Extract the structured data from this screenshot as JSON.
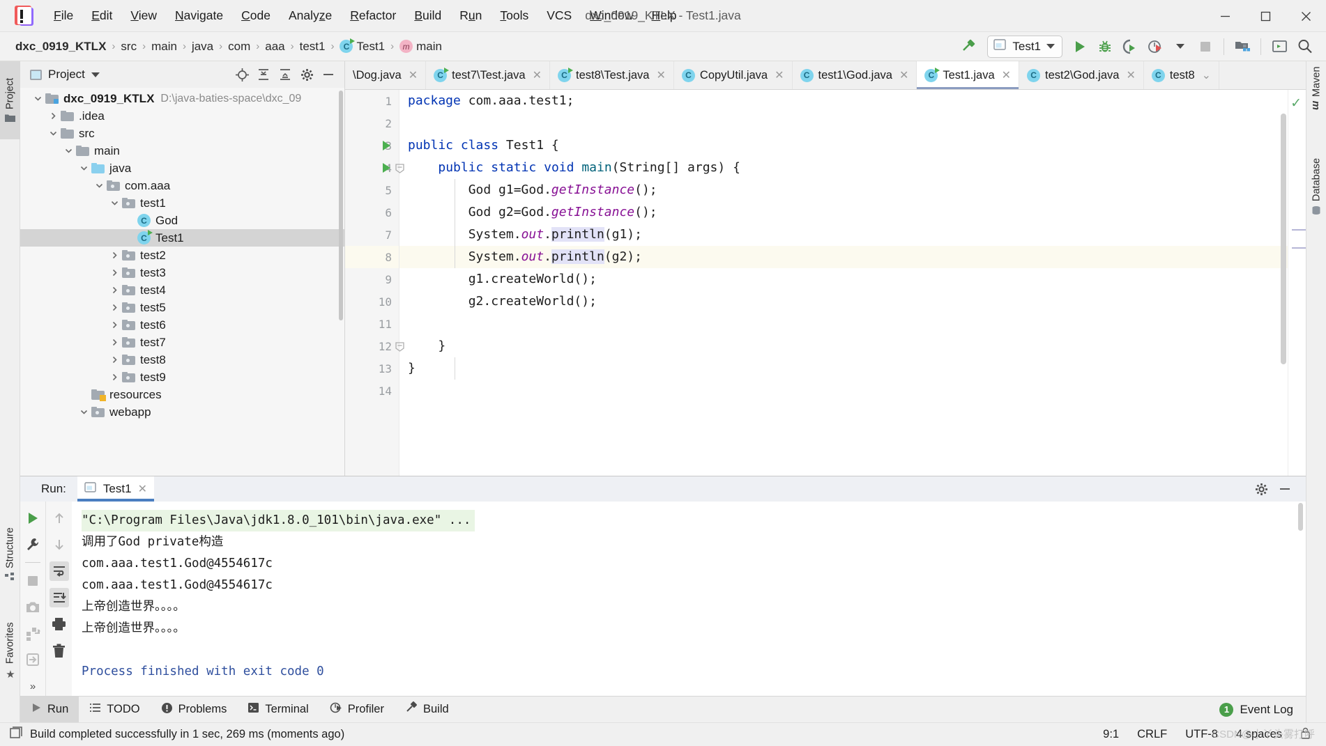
{
  "window": {
    "title": "dxc_0919_KTLX - Test1.java",
    "logo_icon": "intellij-idea-logo",
    "minimize_icon": "minimize-icon",
    "maximize_icon": "maximize-icon",
    "close_icon": "close-icon"
  },
  "menu": [
    {
      "label": "File",
      "mnemonic": "F"
    },
    {
      "label": "Edit",
      "mnemonic": "E"
    },
    {
      "label": "View",
      "mnemonic": "V"
    },
    {
      "label": "Navigate",
      "mnemonic": "N"
    },
    {
      "label": "Code",
      "mnemonic": "C"
    },
    {
      "label": "Analyze",
      "mnemonic": "z"
    },
    {
      "label": "Refactor",
      "mnemonic": "R"
    },
    {
      "label": "Build",
      "mnemonic": "B"
    },
    {
      "label": "Run",
      "mnemonic": "u"
    },
    {
      "label": "Tools",
      "mnemonic": "T"
    },
    {
      "label": "VCS",
      "mnemonic": ""
    },
    {
      "label": "Window",
      "mnemonic": "W"
    },
    {
      "label": "Help",
      "mnemonic": "H"
    }
  ],
  "breadcrumbs": [
    {
      "label": "dxc_0919_KTLX",
      "icon": "",
      "bold": true
    },
    {
      "label": "src",
      "icon": ""
    },
    {
      "label": "main",
      "icon": ""
    },
    {
      "label": "java",
      "icon": ""
    },
    {
      "label": "com",
      "icon": ""
    },
    {
      "label": "aaa",
      "icon": ""
    },
    {
      "label": "test1",
      "icon": ""
    },
    {
      "label": "Test1",
      "icon": "class-icon"
    },
    {
      "label": "main",
      "icon": "method-icon"
    }
  ],
  "toolbar": {
    "build_icon": "hammer-icon",
    "run_config_label": "Test1",
    "run_config_icon": "run-config-icon",
    "run_icon": "run-icon",
    "debug_icon": "debug-bug-icon",
    "coverage_icon": "run-with-coverage-icon",
    "profile_icon": "profiler-icon",
    "stop_icon": "stop-icon",
    "project_structure_icon": "project-structure-icon",
    "updates_icon": "terminal-icon",
    "search_icon": "search-everywhere-icon"
  },
  "left_strip": [
    {
      "label": "Project",
      "icon": "project-folder-icon",
      "active": true
    },
    {
      "label": "Structure",
      "icon": "structure-icon",
      "active": false
    },
    {
      "label": "Favorites",
      "icon": "star-icon",
      "active": false
    }
  ],
  "right_strip": [
    {
      "label": "Maven",
      "icon": "maven-icon"
    },
    {
      "label": "Database",
      "icon": "database-icon"
    }
  ],
  "project_panel": {
    "title": "Project",
    "title_icon": "project-window-icon",
    "dropdown_icon": "chevron-down-icon",
    "actions": [
      {
        "icon": "locate-icon",
        "name": "select-opened-file"
      },
      {
        "icon": "expand-all-icon",
        "name": "expand-all"
      },
      {
        "icon": "collapse-all-icon",
        "name": "collapse-all"
      },
      {
        "icon": "gear-icon",
        "name": "options"
      },
      {
        "icon": "minimize-icon",
        "name": "hide-panel"
      }
    ],
    "tree": [
      {
        "label": "dxc_0919_KTLX",
        "path": "D:\\java-baties-space\\dxc_09",
        "depth": 0,
        "arrow": "down",
        "icon": "module-folder",
        "bold": true
      },
      {
        "label": ".idea",
        "path": "",
        "depth": 1,
        "arrow": "right",
        "icon": "folder"
      },
      {
        "label": "src",
        "path": "",
        "depth": 1,
        "arrow": "down",
        "icon": "folder"
      },
      {
        "label": "main",
        "path": "",
        "depth": 2,
        "arrow": "down",
        "icon": "folder"
      },
      {
        "label": "java",
        "path": "",
        "depth": 3,
        "arrow": "down",
        "icon": "source-folder"
      },
      {
        "label": "com.aaa",
        "path": "",
        "depth": 4,
        "arrow": "down",
        "icon": "package"
      },
      {
        "label": "test1",
        "path": "",
        "depth": 5,
        "arrow": "down",
        "icon": "package"
      },
      {
        "label": "God",
        "path": "",
        "depth": 6,
        "arrow": "none",
        "icon": "class"
      },
      {
        "label": "Test1",
        "path": "",
        "depth": 6,
        "arrow": "none",
        "icon": "class-runnable",
        "selected": true
      },
      {
        "label": "test2",
        "path": "",
        "depth": 5,
        "arrow": "right",
        "icon": "package"
      },
      {
        "label": "test3",
        "path": "",
        "depth": 5,
        "arrow": "right",
        "icon": "package"
      },
      {
        "label": "test4",
        "path": "",
        "depth": 5,
        "arrow": "right",
        "icon": "package"
      },
      {
        "label": "test5",
        "path": "",
        "depth": 5,
        "arrow": "right",
        "icon": "package"
      },
      {
        "label": "test6",
        "path": "",
        "depth": 5,
        "arrow": "right",
        "icon": "package"
      },
      {
        "label": "test7",
        "path": "",
        "depth": 5,
        "arrow": "right",
        "icon": "package"
      },
      {
        "label": "test8",
        "path": "",
        "depth": 5,
        "arrow": "right",
        "icon": "package"
      },
      {
        "label": "test9",
        "path": "",
        "depth": 5,
        "arrow": "right",
        "icon": "package"
      },
      {
        "label": "resources",
        "path": "",
        "depth": 3,
        "arrow": "none",
        "icon": "resource-folder"
      },
      {
        "label": "webapp",
        "path": "",
        "depth": 3,
        "arrow": "down",
        "icon": "package"
      }
    ]
  },
  "editor": {
    "tabs": [
      {
        "label": "\\Dog.java",
        "icon": "class-icon",
        "active": false,
        "partial": true
      },
      {
        "label": "test7\\Test.java",
        "icon": "class-runnable-icon",
        "active": false
      },
      {
        "label": "test8\\Test.java",
        "icon": "class-runnable-icon",
        "active": false
      },
      {
        "label": "CopyUtil.java",
        "icon": "class-icon",
        "active": false
      },
      {
        "label": "test1\\God.java",
        "icon": "class-icon",
        "active": false
      },
      {
        "label": "Test1.java",
        "icon": "class-runnable-icon",
        "active": true
      },
      {
        "label": "test2\\God.java",
        "icon": "class-icon",
        "active": false
      },
      {
        "label": "test8",
        "icon": "class-icon",
        "active": false,
        "truncated": true
      }
    ],
    "tabs_overflow_icon": "chevron-down-icon",
    "inspection_ok_icon": "inspection-ok-check",
    "current_line": 8,
    "lines": [
      {
        "n": 1,
        "text": "package com.aaa.test1;",
        "runnable": false
      },
      {
        "n": 2,
        "text": "",
        "runnable": false
      },
      {
        "n": 3,
        "text": "public class Test1 {",
        "runnable": true
      },
      {
        "n": 4,
        "text": "    public static void main(String[] args) {",
        "runnable": true,
        "fold": true
      },
      {
        "n": 5,
        "text": "        God g1=God.getInstance();",
        "runnable": false
      },
      {
        "n": 6,
        "text": "        God g2=God.getInstance();",
        "runnable": false
      },
      {
        "n": 7,
        "text": "        System.out.println(g1);",
        "runnable": false
      },
      {
        "n": 8,
        "text": "        System.out.println(g2);",
        "runnable": false
      },
      {
        "n": 9,
        "text": "        g1.createWorld();",
        "runnable": false
      },
      {
        "n": 10,
        "text": "        g2.createWorld();",
        "runnable": false
      },
      {
        "n": 11,
        "text": "",
        "runnable": false
      },
      {
        "n": 12,
        "text": "    }",
        "runnable": false,
        "fold": true
      },
      {
        "n": 13,
        "text": "}",
        "runnable": false
      },
      {
        "n": 14,
        "text": "",
        "runnable": false
      }
    ]
  },
  "run_panel": {
    "label": "Run:",
    "tab_label": "Test1",
    "tab_icon": "run-config-icon",
    "close_icon": "close-icon",
    "settings_icon": "gear-icon",
    "minimize_icon": "minimize-icon",
    "left_actions": [
      {
        "icon": "rerun-icon",
        "name": "rerun-button"
      },
      {
        "icon": "wrench-icon",
        "name": "edit-configuration-button"
      },
      {
        "icon": "stop-icon",
        "name": "stop-button"
      },
      {
        "icon": "camera-icon",
        "name": "snapshot-button"
      },
      {
        "icon": "dump-threads-icon",
        "name": "dump-threads-button"
      },
      {
        "icon": "exit-icon",
        "name": "exit-button"
      },
      {
        "icon": "more-icon",
        "name": "more-actions-button"
      }
    ],
    "right_actions": [
      {
        "icon": "arrow-up-icon",
        "name": "previous-occurrence"
      },
      {
        "icon": "arrow-down-icon",
        "name": "next-occurrence"
      },
      {
        "icon": "soft-wrap-icon",
        "name": "soft-wrap-toggle"
      },
      {
        "icon": "scroll-to-end-icon",
        "name": "scroll-to-end"
      },
      {
        "icon": "print-icon",
        "name": "print-button"
      },
      {
        "icon": "trash-icon",
        "name": "clear-all-button"
      }
    ],
    "console_lines": [
      {
        "text": "\"C:\\Program Files\\Java\\jdk1.8.0_101\\bin\\java.exe\" ...",
        "style": "command"
      },
      {
        "text": "调用了God private构造",
        "style": "normal"
      },
      {
        "text": "com.aaa.test1.God@4554617c",
        "style": "normal"
      },
      {
        "text": "com.aaa.test1.God@4554617c",
        "style": "normal"
      },
      {
        "text": "上帝创造世界。。。。",
        "style": "normal"
      },
      {
        "text": "上帝创造世界。。。。",
        "style": "normal"
      },
      {
        "text": "",
        "style": "normal"
      },
      {
        "text": "Process finished with exit code 0",
        "style": "system"
      }
    ]
  },
  "bottom_toolbar": {
    "items": [
      {
        "label": "Run",
        "icon": "run-icon",
        "active": true
      },
      {
        "label": "TODO",
        "icon": "todo-list-icon",
        "active": false
      },
      {
        "label": "Problems",
        "icon": "problems-icon",
        "active": false
      },
      {
        "label": "Terminal",
        "icon": "terminal-icon",
        "active": false
      },
      {
        "label": "Profiler",
        "icon": "profiler-icon",
        "active": false
      },
      {
        "label": "Build",
        "icon": "hammer-icon",
        "active": false
      }
    ],
    "event_log_label": "Event Log",
    "event_log_count": "1"
  },
  "statusbar": {
    "message": "Build completed successfully in 1 sec, 269 ms (moments ago)",
    "message_icon": "message-icon",
    "caret_position": "9:1",
    "line_separator": "CRLF",
    "encoding": "UTF-8",
    "indent": "4 spaces",
    "watermark": "CSDN@小丫头雾打呼",
    "lock_icon": "lock-icon"
  },
  "colors": {
    "accent_blue": "#4a7ec0",
    "keyword": "#0033b3",
    "string": "#067d17",
    "field": "#871094",
    "method": "#00627a",
    "green_run": "#4caf50",
    "selection": "#d4d4d4"
  }
}
